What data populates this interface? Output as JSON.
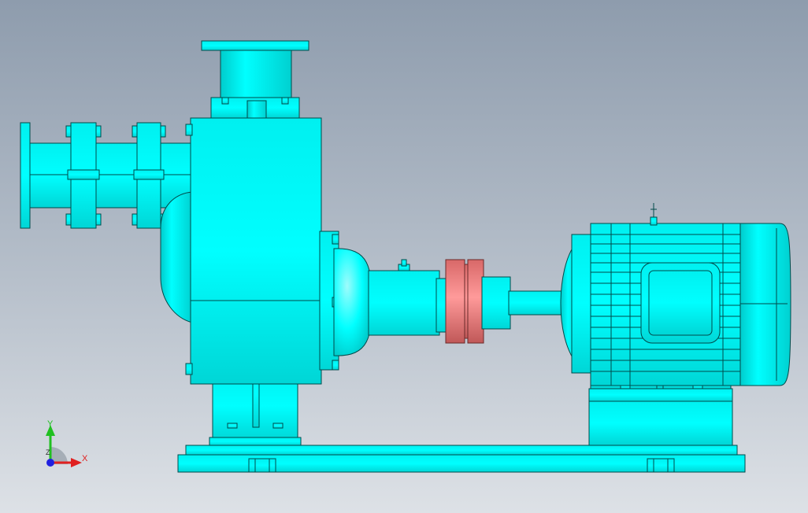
{
  "viewport": {
    "background_top": "#8e9cad",
    "background_bottom": "#dde1e6"
  },
  "model": {
    "parts": [
      "base-plate",
      "pump-body",
      "inlet-pipe",
      "outlet-flange",
      "bearing-housing",
      "coupling",
      "motor"
    ],
    "colors": {
      "body": "#00ffff",
      "body_shade": "#00c8c8",
      "edge": "#004a4a",
      "coupling": "#f08080",
      "coupling_shade": "#c05858"
    }
  },
  "triad": {
    "x_label": "X",
    "y_label": "Y",
    "z_label": "Z",
    "x_color": "#e02020",
    "y_color": "#20c020",
    "z_color": "#2020e0"
  }
}
